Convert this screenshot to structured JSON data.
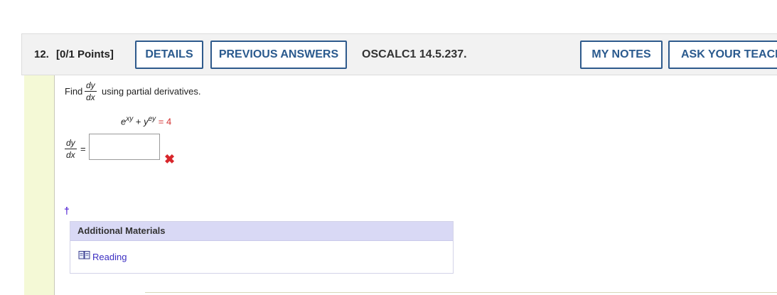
{
  "question": {
    "number": "12.",
    "points": "[0/1 Points]",
    "code": "OSCALC1 14.5.237."
  },
  "buttons": {
    "details": "DETAILS",
    "previous_answers": "PREVIOUS ANSWERS",
    "my_notes": "MY NOTES",
    "ask_teacher": "ASK YOUR TEACHER"
  },
  "prompt": {
    "find": "Find",
    "frac_num": "dy",
    "frac_den": "dx",
    "rest": "using partial derivatives."
  },
  "equation": {
    "base1": "e",
    "exp1": "xy",
    "plus": "+",
    "base2": "y",
    "exp2": "ey",
    "rhs": "= 4"
  },
  "answer": {
    "lhs_num": "dy",
    "lhs_den": "dx",
    "equals": "=",
    "value": "",
    "status": "incorrect"
  },
  "marker": "†",
  "additional_materials": {
    "title": "Additional Materials",
    "reading_label": "Reading"
  },
  "colors": {
    "button_border": "#2e5a8c",
    "gutter": "#f4f9d6",
    "materials_header": "#d9d9f5",
    "error": "#d8262b",
    "link": "#3c2fc2"
  }
}
